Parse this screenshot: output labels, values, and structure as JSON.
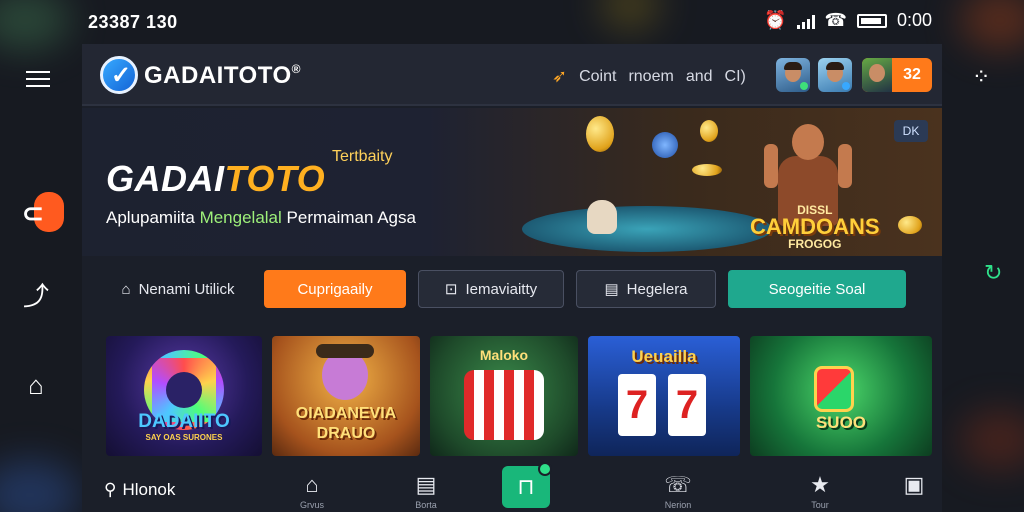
{
  "status_bar": {
    "left_text": "23387 130",
    "time": "0:00"
  },
  "header": {
    "logo": "GADAITOTO",
    "logo_mark": "®",
    "nav_items": [
      "Coint",
      "rnoem",
      "and",
      "CI)"
    ],
    "score": "32"
  },
  "hero": {
    "title_white": "GADAI",
    "title_accent": "TOTO",
    "tag": "Tertbaity",
    "subtitle_prefix": "Aplupamiita ",
    "subtitle_highlight": "Mengelalal",
    "subtitle_suffix": " Permaiman Agsa",
    "logo_main": "CAMDOANS",
    "logo_small": "FROGOG",
    "logo_top": "DISSL",
    "badge": "DK"
  },
  "filters": [
    {
      "label": "Nenami Utilick",
      "icon": "home-icon"
    },
    {
      "label": "Cuprigaaily",
      "icon": ""
    },
    {
      "label": "Iemaviaitty",
      "icon": "lock-icon"
    },
    {
      "label": "Hegelera",
      "icon": "document-icon"
    },
    {
      "label": "Seogeitie Soal",
      "icon": ""
    }
  ],
  "tiles": [
    {
      "label": "DADAIITO",
      "sub": "SAY OAS SURONES"
    },
    {
      "label": "OIADANEVIA",
      "sub": "DRAUO"
    },
    {
      "label": "Maloko",
      "sub": ""
    },
    {
      "label": "Ueuailla",
      "sub": "77"
    },
    {
      "label": "SUOO",
      "sub": ""
    }
  ],
  "bottom_nav": {
    "search_label": "Hlonok",
    "items": [
      "Grvus",
      "Borta",
      "",
      "Nerion",
      "Tour",
      ""
    ]
  },
  "colors": {
    "accent_orange": "#ff7a1a",
    "accent_teal": "#1fa88e",
    "accent_green": "#19b77a",
    "panel_bg": "#1b1f29"
  }
}
